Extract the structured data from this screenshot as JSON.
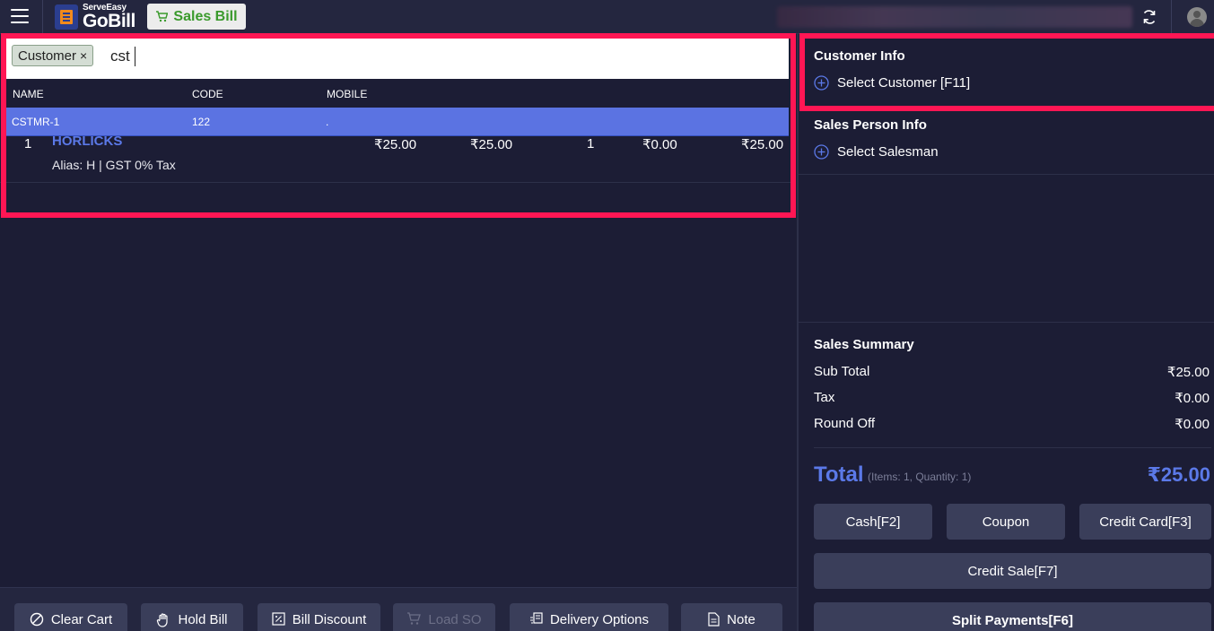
{
  "header": {
    "logo_small": "ServeEasy",
    "logo_big": "GoBill",
    "mode_label": "Sales Bill"
  },
  "search": {
    "chip_label": "Customer",
    "chip_remove": "×",
    "query": "cst",
    "columns": [
      "NAME",
      "CODE",
      "MOBILE"
    ],
    "results": [
      {
        "name": "CSTMR-1",
        "code": "122",
        "mobile": "."
      }
    ]
  },
  "cart": {
    "items": [
      {
        "index": "1",
        "name": "HORLICKS",
        "alias": "Alias: H | GST 0% Tax",
        "mrp": "₹25.00",
        "rate": "₹25.00",
        "qty": "1",
        "discount": "₹0.00",
        "amount": "₹25.00"
      }
    ]
  },
  "bottom_actions": {
    "clear_cart": "Clear Cart",
    "hold_bill": "Hold Bill",
    "bill_discount": "Bill Discount",
    "load_so": "Load SO",
    "delivery_options": "Delivery Options",
    "note": "Note"
  },
  "customer_info": {
    "title": "Customer Info",
    "select_label": "Select Customer [F11]"
  },
  "sales_person_info": {
    "title": "Sales Person Info",
    "select_label": "Select Salesman"
  },
  "summary": {
    "title": "Sales Summary",
    "sub_total_label": "Sub Total",
    "sub_total": "₹25.00",
    "tax_label": "Tax",
    "tax": "₹0.00",
    "round_off_label": "Round Off",
    "round_off": "₹0.00",
    "total_label": "Total",
    "total_detail": "(Items: 1, Quantity: 1)",
    "total": "₹25.00"
  },
  "payment_buttons": {
    "cash": "Cash[F2]",
    "coupon": "Coupon",
    "credit_card": "Credit Card[F3]",
    "credit_sale": "Credit Sale[F7]",
    "split_payments": "Split Payments[F6]"
  },
  "colors": {
    "background": "#1c1d35",
    "accent": "#5b79e8",
    "highlight_row": "#5b73e2",
    "annotation_border": "#ff1654",
    "sales_bill_green": "#3a9a2c"
  }
}
